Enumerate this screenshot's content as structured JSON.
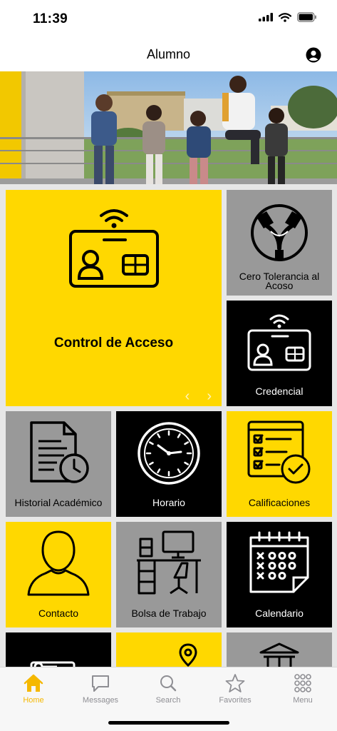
{
  "status_bar": {
    "time": "11:39"
  },
  "navbar": {
    "title": "Alumno"
  },
  "tiles": {
    "control_acceso": "Control de Acceso",
    "cero_tolerancia": "Cero Tolerancia al Acoso",
    "credencial": "Credencial",
    "historial": "Historial Académico",
    "horario": "Horario",
    "calificaciones": "Calificaciones",
    "contacto": "Contacto",
    "bolsa_trabajo": "Bolsa de Trabajo",
    "calendario": "Calendario"
  },
  "tabbar": {
    "items": [
      {
        "label": "Home",
        "icon": "home-icon",
        "active": true
      },
      {
        "label": "Messages",
        "icon": "messages-icon",
        "active": false
      },
      {
        "label": "Search",
        "icon": "search-icon",
        "active": false
      },
      {
        "label": "Favorites",
        "icon": "star-icon",
        "active": false
      },
      {
        "label": "Menu",
        "icon": "grid-menu-icon",
        "active": false
      }
    ]
  },
  "colors": {
    "accent": "#ffd800",
    "gray_tile": "#999999",
    "dark_tile": "#000000",
    "tab_active": "#f5b800"
  }
}
